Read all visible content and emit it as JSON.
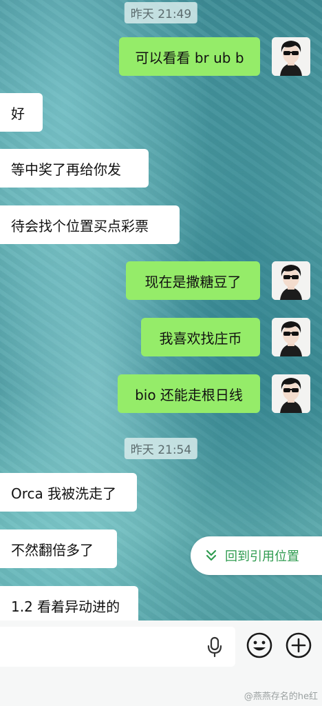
{
  "timestamps": [
    "昨天 21:49",
    "昨天 21:54"
  ],
  "messages": [
    {
      "side": "right",
      "text": "可以看看 br ub b"
    },
    {
      "side": "left",
      "text": "好"
    },
    {
      "side": "left",
      "text": "等中奖了再给你发"
    },
    {
      "side": "left",
      "text": "待会找个位置买点彩票"
    },
    {
      "side": "right",
      "text": "现在是撒糖豆了"
    },
    {
      "side": "right",
      "text": "我喜欢找庄币"
    },
    {
      "side": "right",
      "text": "bio 还能走根日线"
    },
    {
      "side": "left",
      "text": "Orca 我被洗走了"
    },
    {
      "side": "left",
      "text": "不然翻倍多了"
    },
    {
      "side": "left",
      "text": "1.2 看着异动进的"
    }
  ],
  "quote_toast": {
    "label": "回到引用位置",
    "icon": "double-chevron-down-icon"
  },
  "input_bar": {
    "icons": [
      "microphone-icon",
      "emoji-icon",
      "plus-icon"
    ]
  },
  "watermark": "@燕燕存名的he红",
  "colors": {
    "outgoing_bubble": "#95ec69",
    "incoming_bubble": "#ffffff",
    "accent": "#2e9b4f"
  }
}
